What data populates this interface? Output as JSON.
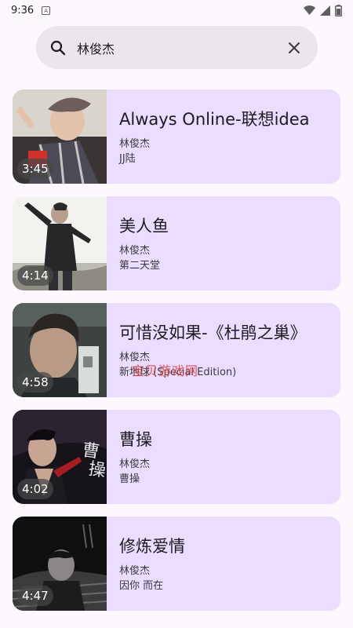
{
  "status_bar": {
    "time": "9:36",
    "notification_glyph": "A",
    "icons": [
      "wifi-icon",
      "signal-icon",
      "battery-icon"
    ]
  },
  "search": {
    "query": "林俊杰",
    "icon": "search-icon",
    "clear_icon": "close-icon"
  },
  "results": [
    {
      "title": "Always Online-联想idea",
      "artist": "林俊杰",
      "album": "JJ陆",
      "duration": "3:45"
    },
    {
      "title": "美人鱼",
      "artist": "林俊杰",
      "album": "第二天堂",
      "duration": "4:14"
    },
    {
      "title": "可惜没如果-《杜鹃之巢》",
      "artist": "林俊杰",
      "album": "新地球 (Special Edition)",
      "duration": "4:58"
    },
    {
      "title": "曹操",
      "artist": "林俊杰",
      "album": "曹操",
      "duration": "4:02"
    },
    {
      "title": "修炼爱情",
      "artist": "林俊杰",
      "album": "因你 而在",
      "duration": "4:47"
    }
  ],
  "watermark": "宝贝游戏网",
  "colors": {
    "background": "#fdf8fd",
    "card": "#eaddff",
    "search_bar": "#ebe5ec",
    "watermark": "#e13a3a"
  }
}
